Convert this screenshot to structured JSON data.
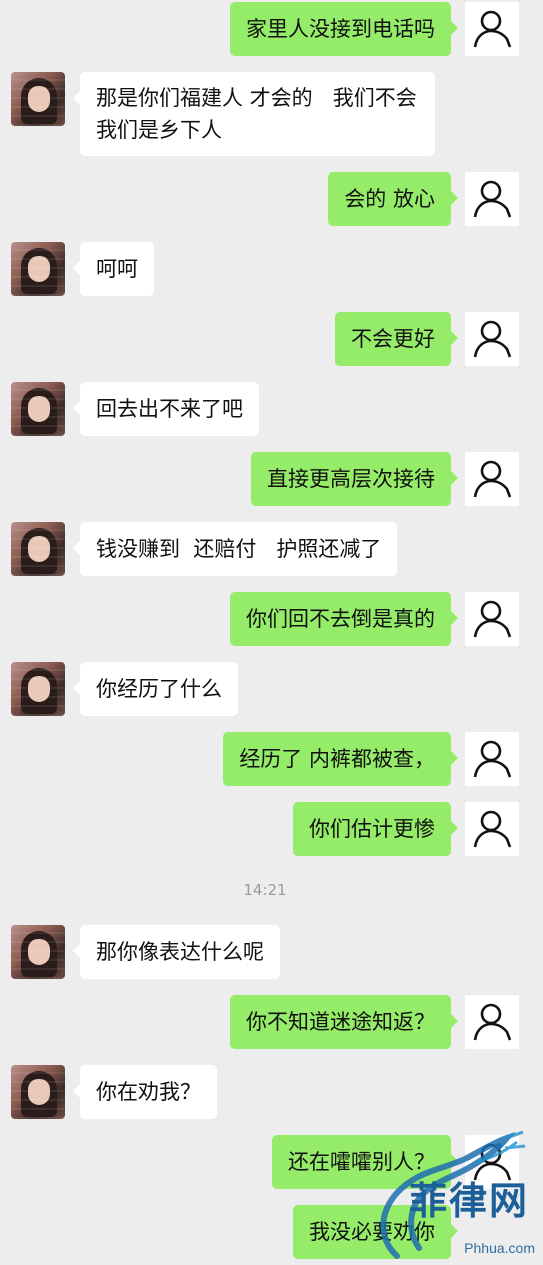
{
  "colors": {
    "background": "#ededed",
    "sent_bubble": "#95ec69",
    "received_bubble": "#ffffff",
    "timestamp_text": "#9b9b9b"
  },
  "messages": [
    {
      "side": "right",
      "text": "家里人没接到电话吗"
    },
    {
      "side": "left",
      "text": "那是你们福建人 才会的   我们不会  我们是乡下人"
    },
    {
      "side": "right",
      "text": "会的 放心"
    },
    {
      "side": "left",
      "text": "呵呵"
    },
    {
      "side": "right",
      "text": "不会更好"
    },
    {
      "side": "left",
      "text": "回去出不来了吧"
    },
    {
      "side": "right",
      "text": "直接更高层次接待"
    },
    {
      "side": "left",
      "text": "钱没赚到  还赔付   护照还减了"
    },
    {
      "side": "right",
      "text": "你们回不去倒是真的"
    },
    {
      "side": "left",
      "text": "你经历了什么"
    },
    {
      "side": "right",
      "text": "经历了 内裤都被查，"
    },
    {
      "side": "right",
      "text": "你们估计更惨"
    },
    {
      "side": "left",
      "text": "那你像表达什么呢"
    },
    {
      "side": "right",
      "text": "你不知道迷途知返？"
    },
    {
      "side": "left",
      "text": "你在劝我？"
    },
    {
      "side": "right",
      "text": "还在嚯嚯别人？"
    },
    {
      "side": "right",
      "text": "我没必要劝你"
    }
  ],
  "timestamp": "14:21",
  "watermark": {
    "brand": "菲律网",
    "url": "Phhua.com"
  }
}
